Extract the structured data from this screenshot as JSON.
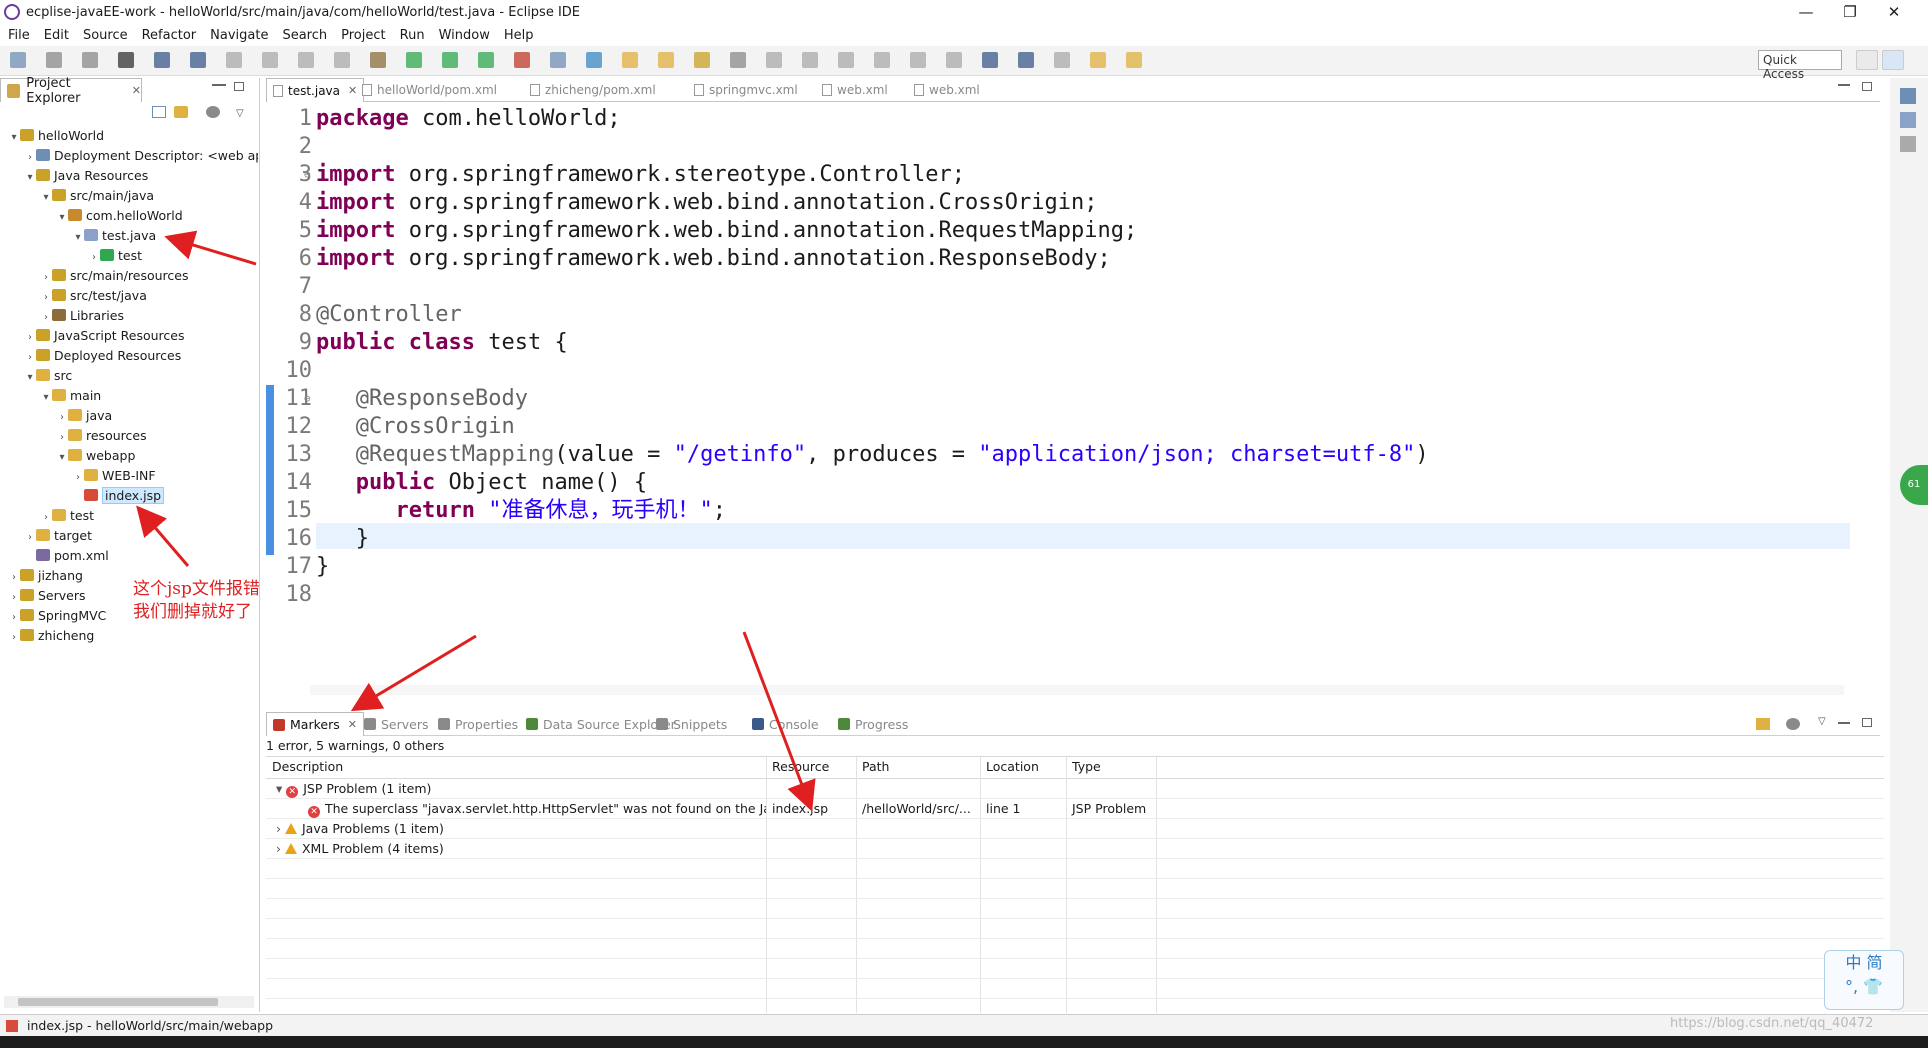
{
  "window": {
    "title": "ecplise-javaEE-work - helloWorld/src/main/java/com/helloWorld/test.java - Eclipse IDE",
    "minimize": "—",
    "restore": "❐",
    "close": "✕"
  },
  "menu": [
    "File",
    "Edit",
    "Source",
    "Refactor",
    "Navigate",
    "Search",
    "Project",
    "Run",
    "Window",
    "Help"
  ],
  "quick_access": "Quick Access",
  "project_explorer": {
    "tab_label": "Project Explorer",
    "tab_close": "✕",
    "nodes": [
      {
        "label": "helloWorld",
        "depth": 0,
        "tw": "v",
        "icon": "#c9a227"
      },
      {
        "label": "Deployment Descriptor: <web app>",
        "depth": 1,
        "tw": ">",
        "icon": "#6d8fb3"
      },
      {
        "label": "Java Resources",
        "depth": 1,
        "tw": "v",
        "icon": "#c9a227"
      },
      {
        "label": "src/main/java",
        "depth": 2,
        "tw": "v",
        "icon": "#c9a227"
      },
      {
        "label": "com.helloWorld",
        "depth": 3,
        "tw": "v",
        "icon": "#c98a2e"
      },
      {
        "label": "test.java",
        "depth": 4,
        "tw": "v",
        "icon": "#8aa2c8"
      },
      {
        "label": "test",
        "depth": 5,
        "tw": ">",
        "icon": "#2fa84f"
      },
      {
        "label": "src/main/resources",
        "depth": 2,
        "tw": ">",
        "icon": "#c9a227"
      },
      {
        "label": "src/test/java",
        "depth": 2,
        "tw": ">",
        "icon": "#c9a227"
      },
      {
        "label": "Libraries",
        "depth": 2,
        "tw": ">",
        "icon": "#8a6d3b"
      },
      {
        "label": "JavaScript Resources",
        "depth": 1,
        "tw": ">",
        "icon": "#c9a227"
      },
      {
        "label": "Deployed Resources",
        "depth": 1,
        "tw": ">",
        "icon": "#c9a227"
      },
      {
        "label": "src",
        "depth": 1,
        "tw": "v",
        "icon": "#e0b040"
      },
      {
        "label": "main",
        "depth": 2,
        "tw": "v",
        "icon": "#e0b040"
      },
      {
        "label": "java",
        "depth": 3,
        "tw": ">",
        "icon": "#e0b040"
      },
      {
        "label": "resources",
        "depth": 3,
        "tw": ">",
        "icon": "#e0b040"
      },
      {
        "label": "webapp",
        "depth": 3,
        "tw": "v",
        "icon": "#e0b040"
      },
      {
        "label": "WEB-INF",
        "depth": 4,
        "tw": ">",
        "icon": "#e0b040"
      },
      {
        "label": "index.jsp",
        "depth": 4,
        "tw": "",
        "icon": "#d84a3a",
        "selected": true
      },
      {
        "label": "test",
        "depth": 2,
        "tw": ">",
        "icon": "#e0b040"
      },
      {
        "label": "target",
        "depth": 1,
        "tw": ">",
        "icon": "#e0b040"
      },
      {
        "label": "pom.xml",
        "depth": 1,
        "tw": "",
        "icon": "#7a6aa0"
      },
      {
        "label": "jizhang",
        "depth": 0,
        "tw": ">",
        "icon": "#c9a227"
      },
      {
        "label": "Servers",
        "depth": 0,
        "tw": ">",
        "icon": "#c9a227"
      },
      {
        "label": "SpringMVC",
        "depth": 0,
        "tw": ">",
        "icon": "#c9a227"
      },
      {
        "label": "zhicheng",
        "depth": 0,
        "tw": ">",
        "icon": "#c9a227"
      }
    ]
  },
  "editor_tabs": [
    {
      "label": "test.java",
      "active": true,
      "close": "✕"
    },
    {
      "label": "helloWorld/pom.xml",
      "active": false
    },
    {
      "label": "zhicheng/pom.xml",
      "active": false
    },
    {
      "label": "springmvc.xml",
      "active": false
    },
    {
      "label": "web.xml",
      "active": false
    },
    {
      "label": "web.xml",
      "active": false
    }
  ],
  "code": [
    {
      "n": "1",
      "t": [
        [
          "kw",
          "package"
        ],
        [
          "",
          "com.helloWorld;"
        ]
      ]
    },
    {
      "n": "2",
      "t": []
    },
    {
      "n": "3",
      "fold": "⊖",
      "t": [
        [
          "kw",
          "import"
        ],
        [
          "",
          "org.springframework.stereotype.Controller;"
        ]
      ]
    },
    {
      "n": "4",
      "t": [
        [
          "kw",
          "import"
        ],
        [
          "",
          "org.springframework.web.bind.annotation.CrossOrigin;"
        ]
      ]
    },
    {
      "n": "5",
      "t": [
        [
          "kw",
          "import"
        ],
        [
          "",
          "org.springframework.web.bind.annotation.RequestMapping;"
        ]
      ]
    },
    {
      "n": "6",
      "t": [
        [
          "kw",
          "import"
        ],
        [
          "",
          "org.springframework.web.bind.annotation.ResponseBody;"
        ]
      ]
    },
    {
      "n": "7",
      "t": []
    },
    {
      "n": "8",
      "t": [
        [
          "ann",
          "@Controller"
        ]
      ]
    },
    {
      "n": "9",
      "t": [
        [
          "kw",
          "public"
        ],
        [
          "kw",
          "class"
        ],
        [
          "",
          "test {"
        ]
      ]
    },
    {
      "n": "10",
      "t": []
    },
    {
      "n": "11",
      "fold": "⊖",
      "t": [
        [
          "",
          "   "
        ],
        [
          "ann",
          "@ResponseBody"
        ]
      ]
    },
    {
      "n": "12",
      "t": [
        [
          "",
          "   "
        ],
        [
          "ann",
          "@CrossOrigin"
        ]
      ]
    },
    {
      "n": "13",
      "t": [
        [
          "",
          "   "
        ],
        [
          "ann",
          "@RequestMapping"
        ],
        [
          "",
          "(value = "
        ],
        [
          "str",
          "\"/getinfo\""
        ],
        [
          "",
          ", produces = "
        ],
        [
          "str",
          "\"application/json; charset=utf-8\""
        ],
        [
          "",
          ")"
        ]
      ]
    },
    {
      "n": "14",
      "t": [
        [
          "",
          "   "
        ],
        [
          "kw",
          "public"
        ],
        [
          "",
          "Object name() {"
        ]
      ]
    },
    {
      "n": "15",
      "t": [
        [
          "",
          "      "
        ],
        [
          "kw",
          "return"
        ],
        [
          "str",
          "\"准备休息，玩手机！\""
        ],
        [
          "",
          ";"
        ]
      ]
    },
    {
      "n": "16",
      "t": [
        [
          "",
          "   }"
        ]
      ]
    },
    {
      "n": "17",
      "t": [
        [
          "",
          "}"
        ]
      ]
    },
    {
      "n": "18",
      "t": []
    }
  ],
  "bottom_tabs": [
    {
      "label": "Markers",
      "active": true,
      "close": "✕",
      "color": "#c0392b"
    },
    {
      "label": "Servers",
      "active": false,
      "color": "#8a8a8a"
    },
    {
      "label": "Properties",
      "active": false,
      "color": "#8a8a8a"
    },
    {
      "label": "Data Source Explorer",
      "active": false,
      "color": "#4c8a3a"
    },
    {
      "label": "Snippets",
      "active": false,
      "color": "#8a8a8a"
    },
    {
      "label": "Console",
      "active": false,
      "color": "#3a5a8a"
    },
    {
      "label": "Progress",
      "active": false,
      "color": "#4c8a3a"
    }
  ],
  "markers": {
    "summary": "1 error, 5 warnings, 0 others",
    "columns": [
      "Description",
      "Resource",
      "Path",
      "Location",
      "Type"
    ],
    "rows": [
      {
        "tw": "v",
        "kind": "err",
        "desc": "JSP Problem (1 item)",
        "res": "",
        "path": "",
        "loc": "",
        "type": "",
        "indent": 0
      },
      {
        "tw": "",
        "kind": "err",
        "desc": "The superclass \"javax.servlet.http.HttpServlet\" was not found on the Java Build Path",
        "res": "index.jsp",
        "path": "/helloWorld/src/...",
        "loc": "line 1",
        "type": "JSP Problem",
        "indent": 1
      },
      {
        "tw": ">",
        "kind": "warn",
        "desc": "Java Problems (1 item)",
        "res": "",
        "path": "",
        "loc": "",
        "type": "",
        "indent": 0
      },
      {
        "tw": ">",
        "kind": "warn",
        "desc": "XML Problem (4 items)",
        "res": "",
        "path": "",
        "loc": "",
        "type": "",
        "indent": 0
      }
    ]
  },
  "status": {
    "text": "index.jsp - helloWorld/src/main/webapp"
  },
  "annotation": {
    "line1": "这个jsp文件报错",
    "line2": "我们删掉就好了"
  },
  "ime": {
    "top": "中 简",
    "bottom": "°, 👕"
  },
  "right_badge": "61",
  "watermark": "https://blog.csdn.net/qq_40472"
}
